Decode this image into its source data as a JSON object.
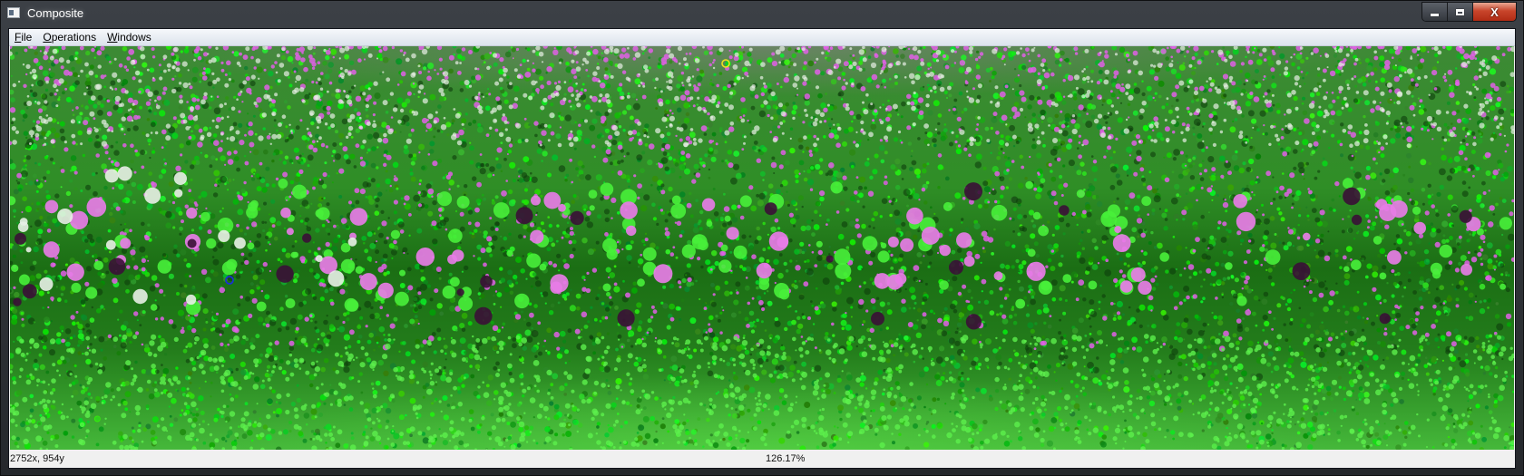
{
  "window": {
    "title": "Composite",
    "controls": {
      "minimize_icon": "minimize-icon",
      "maximize_icon": "maximize-icon",
      "close_icon": "close-icon",
      "close_glyph": "X"
    }
  },
  "menu": {
    "items": [
      {
        "label": "File",
        "mnemonic": "F",
        "rest": "ile"
      },
      {
        "label": "Operations",
        "mnemonic": "O",
        "rest": "perations"
      },
      {
        "label": "Windows",
        "mnemonic": "W",
        "rest": "indows"
      }
    ]
  },
  "viewer": {
    "description_icon": "composite-image",
    "palette": {
      "green": "#33e52a",
      "magenta": "#e060e6",
      "white": "#e8efe6",
      "dark": "#3a0f36"
    },
    "markers": [
      {
        "name": "yellow-circle-marker",
        "color": "#f0e020"
      },
      {
        "name": "blue-circle-marker",
        "color": "#1a2fd6"
      }
    ]
  },
  "status": {
    "coordinates": "2752x, 954y",
    "zoom": "126.17%"
  }
}
